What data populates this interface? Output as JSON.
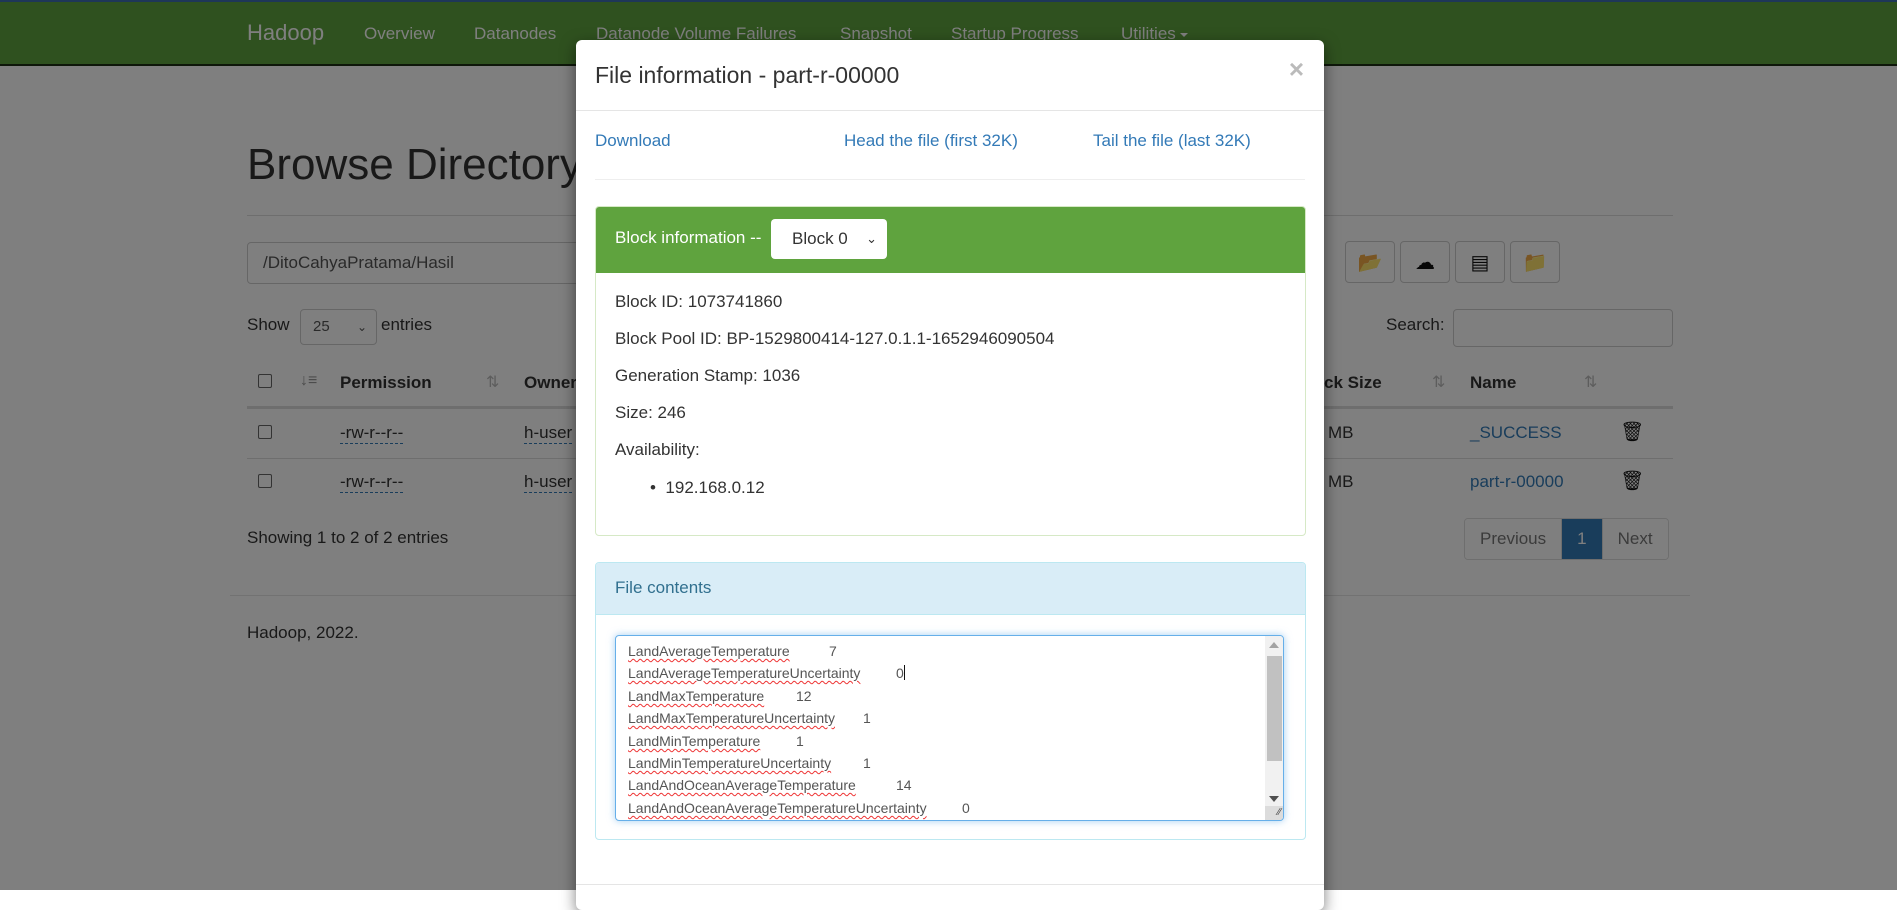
{
  "navbar": {
    "brand": "Hadoop",
    "items": [
      {
        "label": "Overview"
      },
      {
        "label": "Datanodes"
      },
      {
        "label": "Datanode Volume Failures"
      },
      {
        "label": "Snapshot"
      },
      {
        "label": "Startup Progress"
      },
      {
        "label": "Utilities"
      }
    ]
  },
  "page": {
    "title": "Browse Directory",
    "path_value": "/DitoCahyaPratama/Hasil",
    "toolbar_icons": [
      "folder-open-icon",
      "cloud-upload-icon",
      "list-icon",
      "folder-move-icon"
    ],
    "show_label": "Show",
    "entries_per_page": "25",
    "entries_label": "entries",
    "search_label": "Search:",
    "search_value": "",
    "columns": [
      "Permission",
      "Owner",
      "Block Size",
      "Name"
    ],
    "column_visible_fragments": {
      "owner": "Owner",
      "block_size": "ck Size"
    },
    "rows": [
      {
        "permission": "-rw-r--r--",
        "owner": "h-user",
        "block_size": "MB",
        "name": "_SUCCESS"
      },
      {
        "permission": "-rw-r--r--",
        "owner": "h-user",
        "block_size": "MB",
        "name": "part-r-00000"
      }
    ],
    "showing": "Showing 1 to 2 of 2 entries",
    "pagination": {
      "previous": "Previous",
      "current": "1",
      "next": "Next"
    },
    "footer": "Hadoop, 2022."
  },
  "modal": {
    "title": "File information - part-r-00000",
    "close": "×",
    "links": {
      "download": "Download",
      "head": "Head the file (first 32K)",
      "tail": "Tail the file (last 32K)"
    },
    "block_panel": {
      "title": "Block information --",
      "selected_block": "Block 0",
      "block_id": "Block ID: 1073741860",
      "block_pool_id": "Block Pool ID: BP-1529800414-127.0.1.1-1652946090504",
      "generation_stamp": "Generation Stamp: 1036",
      "size": "Size: 246",
      "availability_label": "Availability:",
      "availability": [
        "192.168.0.12"
      ]
    },
    "contents_panel": {
      "title": "File contents",
      "lines": [
        {
          "key": "LandAverageTemperature",
          "value": "7"
        },
        {
          "key": "LandAverageTemperatureUncertainty",
          "value": "0"
        },
        {
          "key": "LandMaxTemperature",
          "value": "12"
        },
        {
          "key": "LandMaxTemperatureUncertainty",
          "value": "1"
        },
        {
          "key": "LandMinTemperature",
          "value": "1"
        },
        {
          "key": "LandMinTemperatureUncertainty",
          "value": "1"
        },
        {
          "key": "LandAndOceanAverageTemperature",
          "value": "14"
        },
        {
          "key": "LandAndOceanAverageTemperatureUncertainty",
          "value": "0"
        }
      ]
    }
  },
  "colors": {
    "navbar_green": "#5fa33e",
    "link_blue": "#337ab7",
    "info_panel_bg": "#d9edf7",
    "info_panel_text": "#31708f"
  }
}
